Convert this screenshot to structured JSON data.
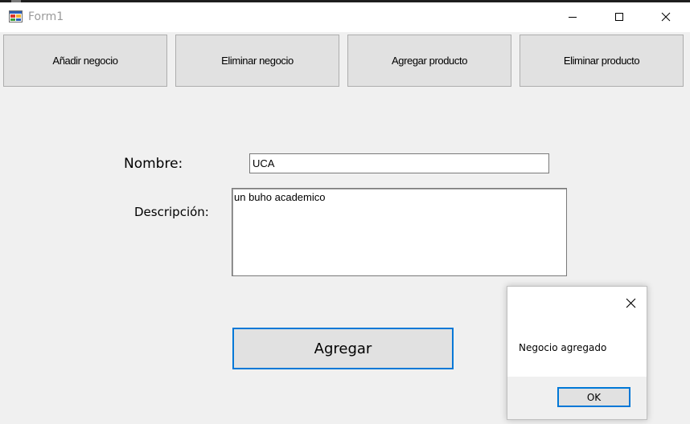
{
  "window": {
    "title": "Form1",
    "icon": "winforms-app-icon"
  },
  "toolbar": {
    "buttons": [
      {
        "label": "Añadir negocio"
      },
      {
        "label": "Eliminar negocio"
      },
      {
        "label": "Agregar producto"
      },
      {
        "label": "Eliminar producto"
      }
    ]
  },
  "form": {
    "nombre_label": "Nombre:",
    "nombre_value": "UCA",
    "descripcion_label": "Descripción:",
    "descripcion_value": "un buho academico",
    "submit_label": "Agregar"
  },
  "message_box": {
    "text": "Negocio agregado",
    "ok_label": "OK"
  },
  "colors": {
    "focus_border": "#0078d7",
    "button_face": "#e1e1e1",
    "form_background": "#f0f0f0"
  }
}
